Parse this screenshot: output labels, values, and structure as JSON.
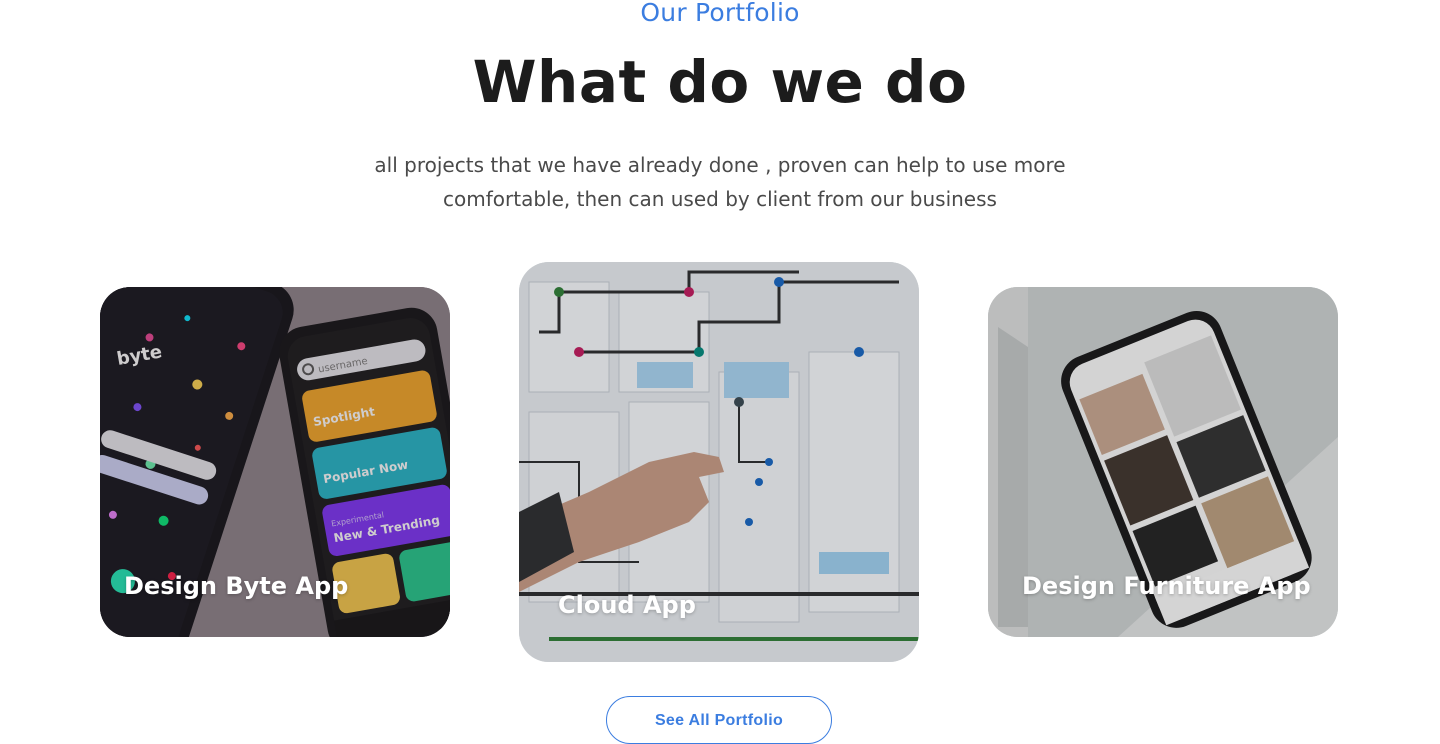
{
  "section": {
    "eyebrow": "Our Portfolio",
    "heading": "What do we do",
    "description_line1": "all projects that we have already done , proven can help to use more",
    "description_line2": "comfortable, then can used by client from our business"
  },
  "portfolio": {
    "items": [
      {
        "title": "Design Byte App"
      },
      {
        "title": "Cloud App"
      },
      {
        "title": "Design Furniture App"
      }
    ],
    "see_all_label": "See All Portfolio"
  },
  "phone_labels": {
    "byte_logo": "byte",
    "search_placeholder": "username",
    "row1": "Spotlight",
    "row2": "Popular Now",
    "row3_small": "Experimental",
    "row3": "New & Trending"
  },
  "colors": {
    "accent": "#3b7de0",
    "heading": "#1c1c1c",
    "body_text": "#4a4a4a"
  }
}
